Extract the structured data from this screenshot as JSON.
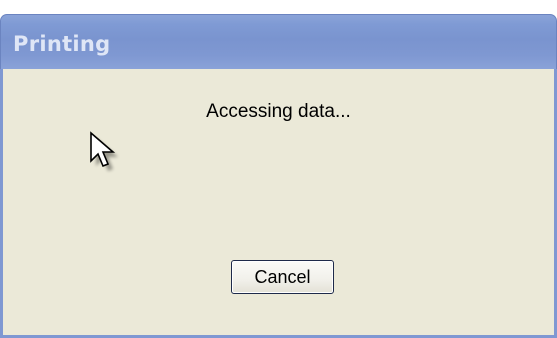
{
  "dialog": {
    "title": "Printing",
    "message": "Accessing data...",
    "cancel_label": "Cancel"
  },
  "icons": {
    "cursor": "mouse-pointer-icon"
  },
  "colors": {
    "titlebar": "#7f98d2",
    "title_text": "#dfe6f6",
    "body_background": "#ebe9d8"
  }
}
